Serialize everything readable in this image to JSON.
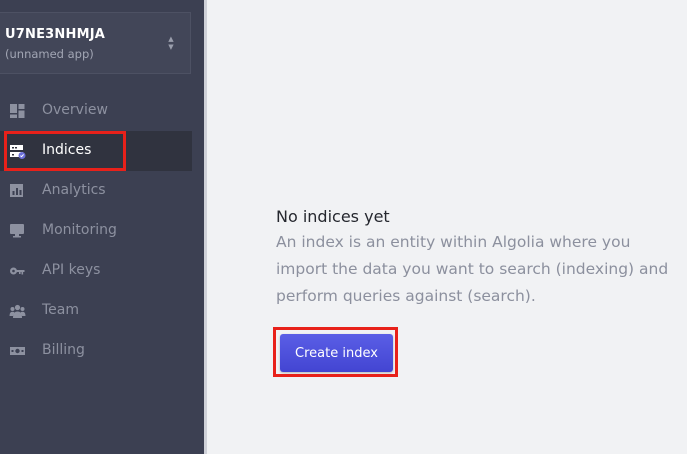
{
  "app": {
    "id": "U7NE3NHMJA",
    "name": "(unnamed app)"
  },
  "sidebar": {
    "items": [
      {
        "label": "Overview",
        "icon": "dashboard-icon",
        "active": false
      },
      {
        "label": "Indices",
        "icon": "indices-icon",
        "active": true
      },
      {
        "label": "Analytics",
        "icon": "bar-chart-icon",
        "active": false
      },
      {
        "label": "Monitoring",
        "icon": "monitor-icon",
        "active": false
      },
      {
        "label": "API keys",
        "icon": "key-icon",
        "active": false
      },
      {
        "label": "Team",
        "icon": "team-icon",
        "active": false
      },
      {
        "label": "Billing",
        "icon": "billing-icon",
        "active": false
      }
    ]
  },
  "main": {
    "empty_title": "No indices yet",
    "empty_description": "An index is an entity within Algolia where you import the data you want to search (indexing) and perform queries against (search).",
    "create_button_label": "Create index"
  },
  "colors": {
    "sidebar_bg": "#3c4052",
    "accent": "#4a4de0",
    "highlight": "#e8211a"
  }
}
